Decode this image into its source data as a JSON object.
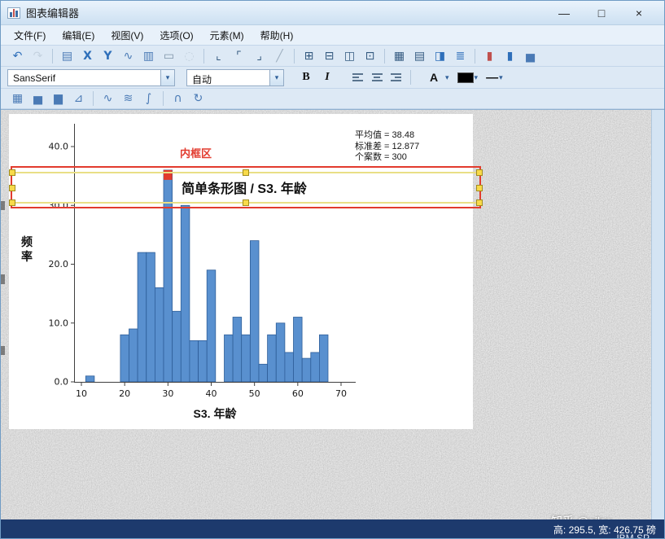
{
  "window": {
    "title": "图表编辑器",
    "buttons": {
      "minimize": "—",
      "maximize": "□",
      "close": "×"
    }
  },
  "menu": {
    "items": [
      {
        "name": "file",
        "label": "文件(F)"
      },
      {
        "name": "edit",
        "label": "编辑(E)"
      },
      {
        "name": "view",
        "label": "视图(V)"
      },
      {
        "name": "options",
        "label": "选项(O)"
      },
      {
        "name": "elements",
        "label": "元素(M)"
      },
      {
        "name": "help",
        "label": "帮助(H)"
      }
    ]
  },
  "main_toolbar": {
    "icons": [
      {
        "name": "undo",
        "glyph": "↶",
        "c": "#2e6fba"
      },
      {
        "name": "redo",
        "glyph": "↷",
        "c": "#9fb0c0",
        "disabled": true
      },
      {
        "sep": true
      },
      {
        "name": "goto-data",
        "glyph": "▤",
        "c": "#4a7ab5"
      },
      {
        "name": "select-x-axis",
        "glyph": "X",
        "c": "#2e6fba",
        "bold": true
      },
      {
        "name": "select-y-axis",
        "glyph": "Y",
        "c": "#2e6fba",
        "bold": true
      },
      {
        "name": "fit-line",
        "glyph": "∿",
        "c": "#4a7ab5"
      },
      {
        "name": "insert-chart",
        "glyph": "▥",
        "c": "#4a7ab5"
      },
      {
        "name": "pan-chart",
        "glyph": "▭",
        "c": "#7e93a8"
      },
      {
        "name": "lasso-select",
        "glyph": "◌",
        "c": "#9fb0c0",
        "disabled": true
      },
      {
        "sep": true
      },
      {
        "name": "y-axis-scale",
        "glyph": "⌞",
        "c": "#33597f"
      },
      {
        "name": "x-axis-scale",
        "glyph": "⌜",
        "c": "#33597f"
      },
      {
        "name": "swap-axes",
        "glyph": "⌟",
        "c": "#33597f"
      },
      {
        "name": "diagonal-reference",
        "glyph": "╱",
        "c": "#9fb0c0"
      },
      {
        "sep": true
      },
      {
        "name": "transpose-chart",
        "glyph": "⊞",
        "c": "#33597f"
      },
      {
        "name": "panel-frame",
        "glyph": "⊟",
        "c": "#33597f"
      },
      {
        "name": "outer-frame",
        "glyph": "◫",
        "c": "#33597f"
      },
      {
        "name": "inner-frame",
        "glyph": "⊡",
        "c": "#33597f"
      },
      {
        "sep": true
      },
      {
        "name": "show-grid",
        "glyph": "▦",
        "c": "#33597f"
      },
      {
        "name": "hide-grid",
        "glyph": "▤",
        "c": "#33597f"
      },
      {
        "name": "show-legend",
        "glyph": "◨",
        "c": "#2e6fba"
      },
      {
        "name": "text-style",
        "glyph": "≣",
        "c": "#2e6fba"
      },
      {
        "sep": true
      },
      {
        "name": "data-label-mode",
        "glyph": "▮",
        "c": "#c0504d"
      },
      {
        "name": "show-data-labels",
        "glyph": "▮",
        "c": "#2e6fba"
      },
      {
        "name": "add-histogram",
        "glyph": "▅",
        "c": "#4a7ab5"
      }
    ]
  },
  "format_toolbar": {
    "font_family": "SansSerif",
    "font_style": "自动",
    "bold_label": "B",
    "italic_label": "I",
    "align_buttons": [
      "align-left",
      "align-center",
      "align-right"
    ],
    "text_color_label": "A",
    "color_swatch": "#000000",
    "line_style_label": "—",
    "dropdown_arrow": "▾"
  },
  "element_toolbar": {
    "icons": [
      {
        "name": "chart-gallery",
        "glyph": "▦",
        "c": "#4a7ab5"
      },
      {
        "name": "add-bar-element",
        "glyph": "▅",
        "c": "#4a7ab5"
      },
      {
        "name": "add-dual-bar-element",
        "glyph": "▆",
        "c": "#4a7ab5"
      },
      {
        "name": "add-line-element",
        "glyph": "⊿",
        "c": "#4a7ab5"
      },
      {
        "sep": true
      },
      {
        "name": "add-fit-line-total",
        "glyph": "∿",
        "c": "#4a7ab5"
      },
      {
        "name": "add-fit-line-subgroups",
        "glyph": "≋",
        "c": "#4a7ab5"
      },
      {
        "name": "add-interpolation-line",
        "glyph": "∫",
        "c": "#4a7ab5"
      },
      {
        "sep": true
      },
      {
        "name": "add-distribution-curve",
        "glyph": "∩",
        "c": "#4a7ab5"
      },
      {
        "name": "rotate-chart",
        "glyph": "↻",
        "c": "#4a7ab5"
      }
    ]
  },
  "chart": {
    "stats_lines": [
      "平均值 = 38.48",
      "标准差 = 12.877",
      "个案数 = 300"
    ],
    "inner_frame_label": "内框区"
  },
  "chart_data": {
    "type": "bar",
    "title": "简单条形图 / S3. 年龄",
    "xlabel": "S3. 年龄",
    "ylabel": "频率",
    "x": [
      12,
      20,
      22,
      24,
      26,
      28,
      30,
      32,
      34,
      36,
      38,
      40,
      44,
      46,
      48,
      50,
      52,
      54,
      56,
      58,
      60,
      62,
      64,
      66
    ],
    "values": [
      1,
      8,
      9,
      22,
      22,
      16,
      36,
      12,
      30,
      7,
      7,
      19,
      8,
      11,
      8,
      24,
      3,
      8,
      10,
      5,
      11,
      4,
      5,
      8
    ],
    "bin_width": 2,
    "xlim": [
      8,
      72
    ],
    "ylim": [
      0,
      44
    ],
    "xticks": [
      "10",
      "20",
      "30",
      "40",
      "50",
      "60",
      "70"
    ],
    "yticks": [
      "0.0",
      "10.0",
      "20.0",
      "30.0",
      "40.0"
    ],
    "grid": false,
    "legend": "none",
    "bar_color": "#5990cf",
    "bar_border": "#2f5f99",
    "stats": {
      "mean": 38.48,
      "std_dev": 12.877,
      "n": 300
    }
  },
  "colors": {
    "selection_red": "#e23b2e",
    "selection_yellow": "#e9df86",
    "selection_handle": "#f8da4a",
    "statusbar_blue": "#1d3a6d"
  },
  "status_bar": {
    "size_text": "高: 295.5, 宽: 426.75 磅",
    "app_text": "IBM SP",
    "watermark": "知乎 @ailsa"
  }
}
